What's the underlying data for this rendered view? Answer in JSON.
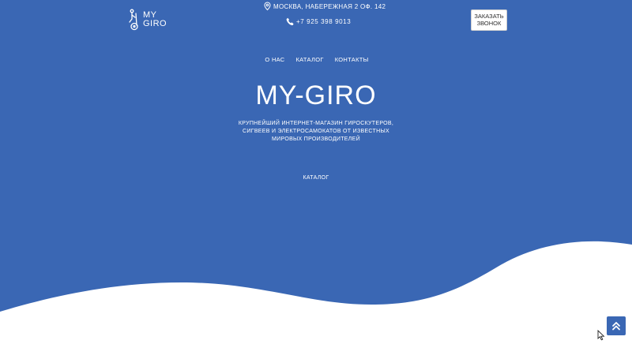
{
  "header": {
    "logo": {
      "icon": "segway-icon",
      "line1": "MY",
      "line2": "GIRO"
    },
    "address": {
      "icon": "location-icon",
      "text": "МОСКВА, НАБЕРЕЖНАЯ 2 ОФ. 142"
    },
    "phone": {
      "icon": "phone-icon",
      "text": "+7 925 398 9013"
    },
    "callback_button": {
      "line1": "ЗАКАЗАТЬ",
      "line2": "ЗВОНОК"
    }
  },
  "nav": {
    "items": [
      {
        "label": "О НАС"
      },
      {
        "label": "КАТАЛОГ"
      },
      {
        "label": "КОНТАКТЫ"
      }
    ]
  },
  "hero": {
    "title": "MY-GIRO",
    "subtitle_lines": [
      "КРУПНЕЙШИЙ ИНТЕРНЕТ-МАГАЗИН ГИРОСКУТЕРОВ,",
      "СИГВЕЕВ И ЭЛЕКТРОСАМОКАТОВ ОТ ИЗВЕСТНЫХ",
      "МИРОВЫХ ПРОИЗВОДИТЕЛЕЙ"
    ],
    "catalog_link": "КАТАЛОГ"
  },
  "scroll_top": {
    "icon": "double-chevron-up-icon"
  },
  "colors": {
    "primary": "#3a67b4",
    "wave": "#ffffff",
    "text": "#ffffff"
  }
}
